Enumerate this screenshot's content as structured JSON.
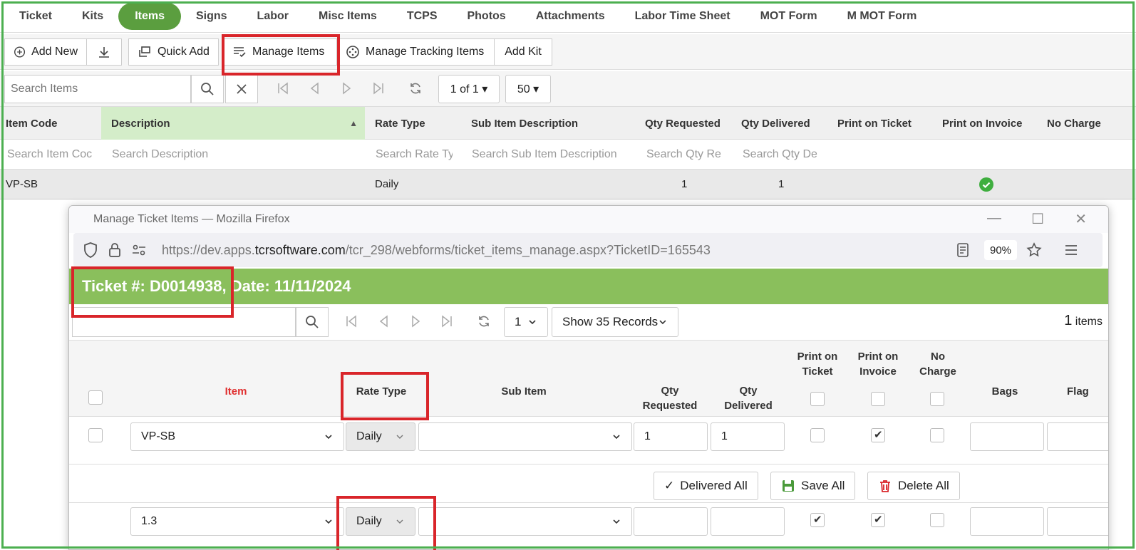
{
  "tabs": [
    "Ticket",
    "Kits",
    "Items",
    "Signs",
    "Labor",
    "Misc Items",
    "TCPS",
    "Photos",
    "Attachments",
    "Labor Time Sheet",
    "MOT Form",
    "M MOT Form"
  ],
  "active_tab": "Items",
  "toolbar": {
    "add_new": "Add New",
    "quick_add": "Quick Add",
    "manage_items": "Manage Items",
    "manage_tracking": "Manage Tracking Items",
    "add_kit": "Add Kit"
  },
  "search": {
    "placeholder": "Search Items",
    "page": "1 of 1 ▾",
    "page_size": "50 ▾"
  },
  "grid": {
    "columns": [
      "Item Code",
      "Description",
      "Rate Type",
      "Sub Item Description",
      "Qty Requested",
      "Qty Delivered",
      "Print on Ticket",
      "Print on Invoice",
      "No Charge"
    ],
    "filters": [
      "Search Item Coc",
      "Search Description",
      "Search Rate Ty",
      "Search Sub Item Description",
      "Search Qty Re",
      "Search Qty De"
    ],
    "row": {
      "item_code": "VP-SB",
      "rate_type": "Daily",
      "qty_requested": "1",
      "qty_delivered": "1"
    }
  },
  "popup": {
    "title": "Manage Ticket Items — Mozilla Firefox",
    "url_prefix": "https://dev.apps.",
    "url_domain": "tcrsoftware.com",
    "url_path": "/tcr_298/webforms/ticket_items_manage.aspx?TicketID=165543",
    "zoom": "90%",
    "header": "Ticket #: D0014938, Date: 11/11/2024",
    "page_select": "1",
    "records_select": "Show 35 Records",
    "items_count": "1",
    "items_label": "items",
    "columns": {
      "item": "Item",
      "rate_type": "Rate Type",
      "sub_item": "Sub Item",
      "qty_requested": "Qty Requested",
      "qty_delivered": "Qty Delivered",
      "print_ticket": "Print on Ticket",
      "print_invoice": "Print on Invoice",
      "no_charge": "No Charge",
      "bags": "Bags",
      "flag": "Flag"
    },
    "rows": [
      {
        "item": "VP-SB",
        "rate_type": "Daily",
        "qty_requested": "1",
        "qty_delivered": "1"
      },
      {
        "item": "1.3",
        "rate_type": "Daily",
        "qty_requested": "",
        "qty_delivered": ""
      }
    ],
    "actions": {
      "delivered_all": "Delivered All",
      "save_all": "Save All",
      "delete_all": "Delete All"
    }
  },
  "colors": {
    "accent_green": "#5b9e3f",
    "header_green": "#8abf5c",
    "highlight_red": "#d9252a",
    "frame_green": "#4caf50"
  }
}
